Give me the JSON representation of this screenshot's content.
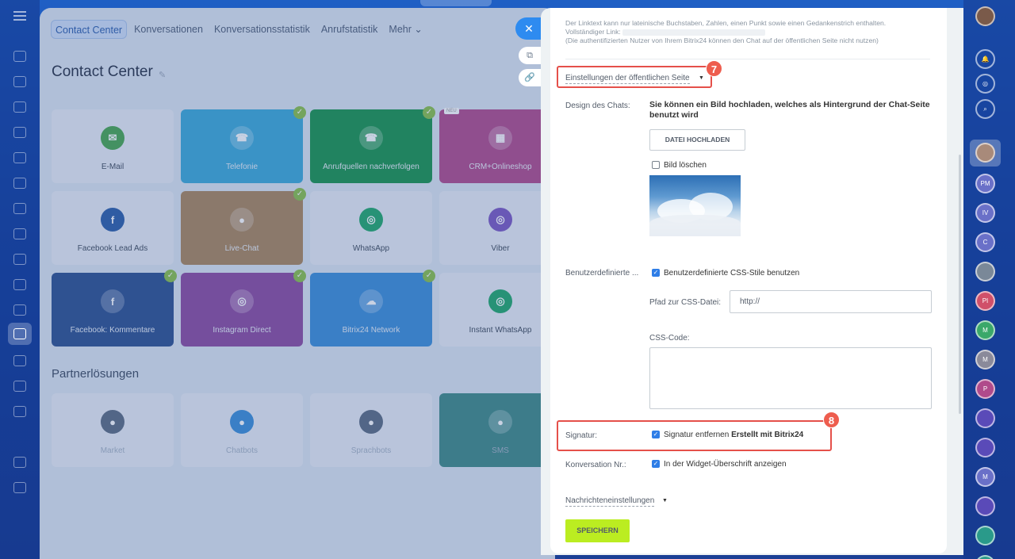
{
  "tabs": [
    "Contact Center",
    "Konversationen",
    "Konversationsstatistik",
    "Anrufstatistik",
    "Mehr ⌄"
  ],
  "page_title": "Contact Center",
  "tiles": [
    {
      "label": "E-Mail",
      "color": "#47a74e",
      "icon": "✉",
      "checked": false,
      "style": ""
    },
    {
      "label": "Telefonie",
      "color": "#39a9d8",
      "icon": "☎",
      "checked": true,
      "style": "dark"
    },
    {
      "label": "Anrufquellen nachverfolgen",
      "color": "#17944b",
      "icon": "☎",
      "checked": true,
      "style": "dark"
    },
    {
      "label": "CRM+Onlineshop",
      "color": "#b04a8b",
      "icon": "▦",
      "checked": false,
      "style": "dark",
      "badge": "NEU"
    },
    {
      "label": "Facebook Lead Ads",
      "color": "#2a5da8",
      "icon": "f",
      "checked": false,
      "style": ""
    },
    {
      "label": "Live-Chat",
      "color": "#a9855a",
      "icon": "●",
      "checked": true,
      "style": "dark"
    },
    {
      "label": "WhatsApp",
      "color": "#1fa86a",
      "icon": "◎",
      "checked": false,
      "style": ""
    },
    {
      "label": "Viber",
      "color": "#7a58c3",
      "icon": "◎",
      "checked": false,
      "style": ""
    },
    {
      "label": "Facebook: Kommentare",
      "color": "#2a4f8f",
      "icon": "f",
      "checked": true,
      "style": "dark"
    },
    {
      "label": "Instagram Direct",
      "color": "#8b4aa0",
      "icon": "◎",
      "checked": true,
      "style": "dark"
    },
    {
      "label": "Bitrix24 Network",
      "color": "#3a8ed8",
      "icon": "☁",
      "checked": true,
      "style": "dark"
    },
    {
      "label": "Instant WhatsApp",
      "color": "#1fa86a",
      "icon": "◎",
      "checked": false,
      "style": ""
    }
  ],
  "partner_title": "Partnerlösungen",
  "partner_tiles": [
    {
      "label": "Market",
      "color": "#5a6b82"
    },
    {
      "label": "Chatbots",
      "color": "#3a8ed8"
    },
    {
      "label": "Sprachbots",
      "color": "#5a6b82"
    },
    {
      "label": "SMS",
      "color": "#3d8a86"
    }
  ],
  "note": {
    "line1": "Der Linktext kann nur lateinische Buchstaben, Zahlen, einen Punkt sowie einen Gedankenstrich enthalten.",
    "line2": "Vollständiger Link:",
    "line3": "(Die authentifizierten Nutzer von Ihrem Bitrix24 können den Chat auf der öffentlichen Seite nicht nutzen)"
  },
  "public_page_section": "Einstellungen der öffentlichen Seite",
  "badge7": "7",
  "badge8": "8",
  "design_label": "Design des Chats:",
  "design_text": "Sie können ein Bild hochladen, welches als Hintergrund der Chat-Seite benutzt wird",
  "upload_button": "DATEI HOCHLADEN",
  "delete_image": "Bild löschen",
  "custom_label": "Benutzerdefinierte ...",
  "custom_css_check": "Benutzerdefinierte CSS-Stile benutzen",
  "css_path_label": "Pfad zur CSS-Datei:",
  "css_path_value": "http://",
  "css_code_label": "CSS-Code:",
  "signature_label": "Signatur:",
  "signature_check": "Signatur entfernen",
  "signature_bold": "Erstellt mit Bitrix24",
  "conversation_label": "Konversation Nr.:",
  "conversation_check": "In der Widget-Überschrift anzeigen",
  "message_section": "Nachrichteneinstellungen",
  "save_button": "SPEICHERN",
  "close_icon": "✕",
  "right_avatars": [
    "PM",
    "IV",
    "C",
    "",
    "PI",
    "M",
    "M",
    "P",
    "",
    "",
    "M",
    "",
    "",
    ""
  ]
}
